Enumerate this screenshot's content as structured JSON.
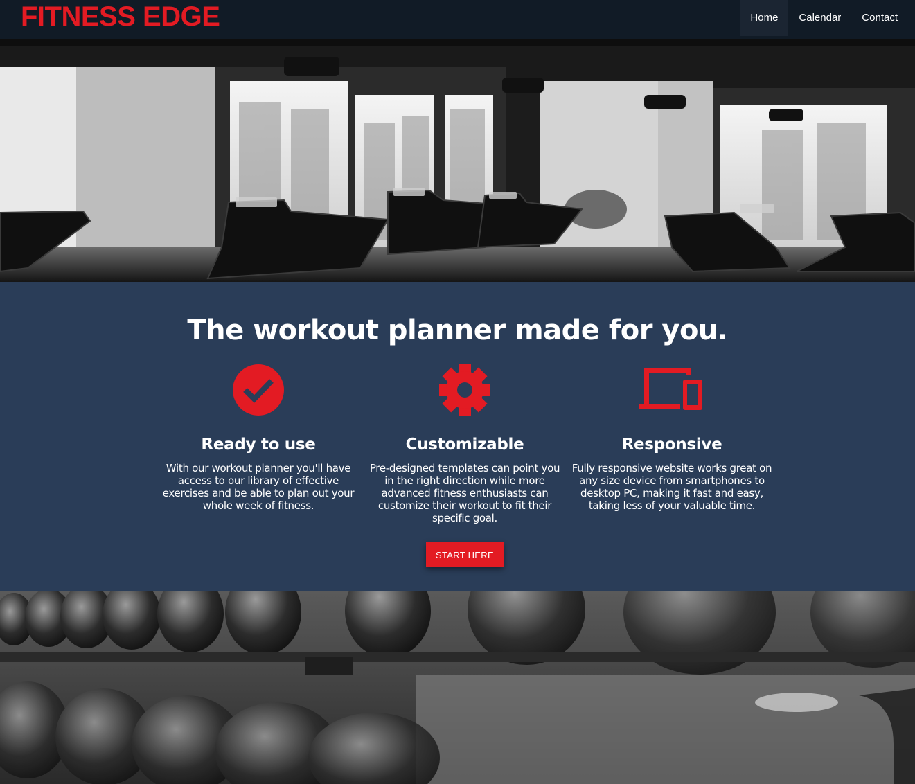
{
  "header": {
    "brand": "FITNESS EDGE",
    "nav": [
      {
        "label": "Home",
        "active": true
      },
      {
        "label": "Calendar",
        "active": false
      },
      {
        "label": "Contact",
        "active": false
      }
    ]
  },
  "hero": {
    "image": "gym-treadmills-photo"
  },
  "features": {
    "title": "The workout planner made for you.",
    "items": [
      {
        "icon": "check-circle-icon",
        "title": "Ready to use",
        "text": "With our workout planner you'll have access to our library of effective exercises and be able to plan out your whole week of fitness."
      },
      {
        "icon": "gear-icon",
        "title": "Customizable",
        "text": "Pre-designed templates can point you in the right direction while more advanced fitness enthusiasts can customize their workout to fit their specific goal."
      },
      {
        "icon": "devices-icon",
        "title": "Responsive",
        "text": "Fully responsive website works great on any size device from smartphones to desktop PC, making it fast and easy, taking less of your valuable time."
      }
    ],
    "cta_label": "START HERE"
  },
  "bottom_image": "dumbbell-rack-photo",
  "colors": {
    "accent": "#e31b23",
    "navbar": "#111b26",
    "panel": "#2a3d58",
    "text": "#ffffff"
  }
}
